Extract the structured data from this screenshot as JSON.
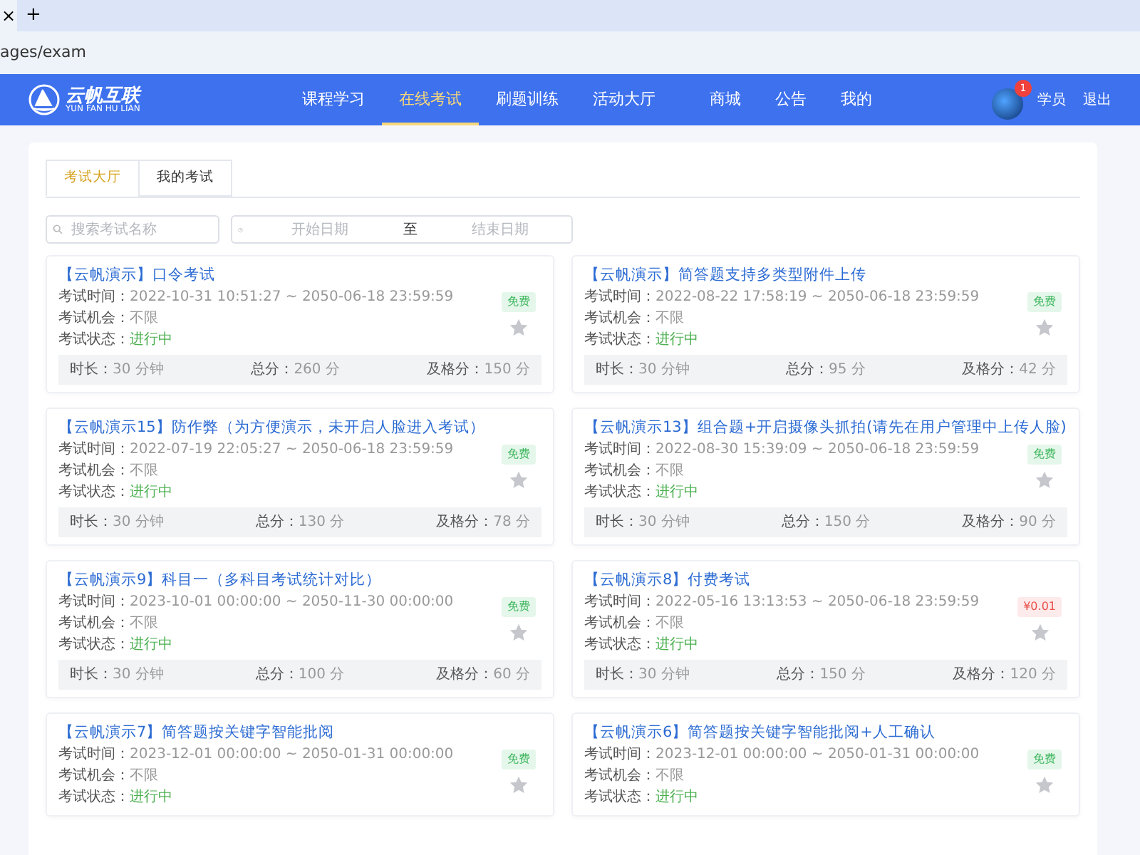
{
  "browser": {
    "tab_close": "×",
    "new_tab": "+",
    "url": "ages/exam"
  },
  "nav": {
    "logo_title": "云帆互联",
    "logo_subtitle": "YUN FAN HU LIAN",
    "items": [
      {
        "label": "课程学习",
        "selected": false
      },
      {
        "label": "在线考试",
        "selected": true
      },
      {
        "label": "刷题训练",
        "selected": false
      },
      {
        "label": "活动大厅",
        "selected": false
      },
      {
        "label": "商城",
        "selected": false
      },
      {
        "label": "公告",
        "selected": false
      },
      {
        "label": "我的",
        "selected": false
      }
    ],
    "user": {
      "badge": "1",
      "role": "学员",
      "logout": "退出"
    }
  },
  "tabs": [
    {
      "label": "考试大厅",
      "selected": true
    },
    {
      "label": "我的考试",
      "selected": false
    }
  ],
  "search": {
    "placeholder": "搜索考试名称"
  },
  "date_range": {
    "start_placeholder": "开始日期",
    "separator": "至",
    "end_placeholder": "结束日期"
  },
  "exams": [
    {
      "title": "【云帆演示】口令考试",
      "time_label": "考试时间：",
      "time": "2022-10-31 10:51:27 ~ 2050-06-18 23:59:59",
      "chance_label": "考试机会：",
      "chance": "不限",
      "status_label": "考试状态：",
      "status": "进行中",
      "paid": false,
      "price": "免费",
      "favorite": false,
      "stats": [
        {
          "label": "时长：",
          "value": "30 分钟"
        },
        {
          "label": "总分：",
          "value": "260 分"
        },
        {
          "label": "及格分：",
          "value": "150 分"
        }
      ]
    },
    {
      "title": "【云帆演示】简答题支持多类型附件上传",
      "time_label": "考试时间：",
      "time": "2022-08-22 17:58:19 ~ 2050-06-18 23:59:59",
      "chance_label": "考试机会：",
      "chance": "不限",
      "status_label": "考试状态：",
      "status": "进行中",
      "paid": false,
      "price": "免费",
      "favorite": false,
      "stats": [
        {
          "label": "时长：",
          "value": "30 分钟"
        },
        {
          "label": "总分：",
          "value": "95 分"
        },
        {
          "label": "及格分：",
          "value": "42 分"
        }
      ]
    },
    {
      "title": "【云帆演示15】防作弊（为方便演示，未开启人脸进入考试）",
      "time_label": "考试时间：",
      "time": "2022-07-19 22:05:27 ~ 2050-06-18 23:59:59",
      "chance_label": "考试机会：",
      "chance": "不限",
      "status_label": "考试状态：",
      "status": "进行中",
      "paid": false,
      "price": "免费",
      "favorite": false,
      "stats": [
        {
          "label": "时长：",
          "value": "30 分钟"
        },
        {
          "label": "总分：",
          "value": "130 分"
        },
        {
          "label": "及格分：",
          "value": "78 分"
        }
      ]
    },
    {
      "title": "【云帆演示13】组合题+开启摄像头抓拍(请先在用户管理中上传人脸)",
      "time_label": "考试时间：",
      "time": "2022-08-30 15:39:09 ~ 2050-06-18 23:59:59",
      "chance_label": "考试机会：",
      "chance": "不限",
      "status_label": "考试状态：",
      "status": "进行中",
      "paid": false,
      "price": "免费",
      "favorite": false,
      "stats": [
        {
          "label": "时长：",
          "value": "30 分钟"
        },
        {
          "label": "总分：",
          "value": "150 分"
        },
        {
          "label": "及格分：",
          "value": "90 分"
        }
      ]
    },
    {
      "title": "【云帆演示9】科目一（多科目考试统计对比）",
      "time_label": "考试时间：",
      "time": "2023-10-01 00:00:00 ~ 2050-11-30 00:00:00",
      "chance_label": "考试机会：",
      "chance": "不限",
      "status_label": "考试状态：",
      "status": "进行中",
      "paid": false,
      "price": "免费",
      "favorite": false,
      "stats": [
        {
          "label": "时长：",
          "value": "30 分钟"
        },
        {
          "label": "总分：",
          "value": "100 分"
        },
        {
          "label": "及格分：",
          "value": "60 分"
        }
      ]
    },
    {
      "title": "【云帆演示8】付费考试",
      "time_label": "考试时间：",
      "time": "2022-05-16 13:13:53 ~ 2050-06-18 23:59:59",
      "chance_label": "考试机会：",
      "chance": "不限",
      "status_label": "考试状态：",
      "status": "进行中",
      "paid": true,
      "price": "¥0.01",
      "favorite": false,
      "stats": [
        {
          "label": "时长：",
          "value": "30 分钟"
        },
        {
          "label": "总分：",
          "value": "150 分"
        },
        {
          "label": "及格分：",
          "value": "120 分"
        }
      ]
    },
    {
      "title": "【云帆演示7】简答题按关键字智能批阅",
      "time_label": "考试时间：",
      "time": "2023-12-01 00:00:00 ~ 2050-01-31 00:00:00",
      "chance_label": "考试机会：",
      "chance": "不限",
      "status_label": "考试状态：",
      "status": "进行中",
      "paid": false,
      "price": "免费",
      "favorite": false
    },
    {
      "title": "【云帆演示6】简答题按关键字智能批阅+人工确认",
      "time_label": "考试时间：",
      "time": "2023-12-01 00:00:00 ~ 2050-01-31 00:00:00",
      "chance_label": "考试机会：",
      "chance": "不限",
      "status_label": "考试状态：",
      "status": "进行中",
      "paid": false,
      "price": "免费",
      "favorite": false
    }
  ]
}
